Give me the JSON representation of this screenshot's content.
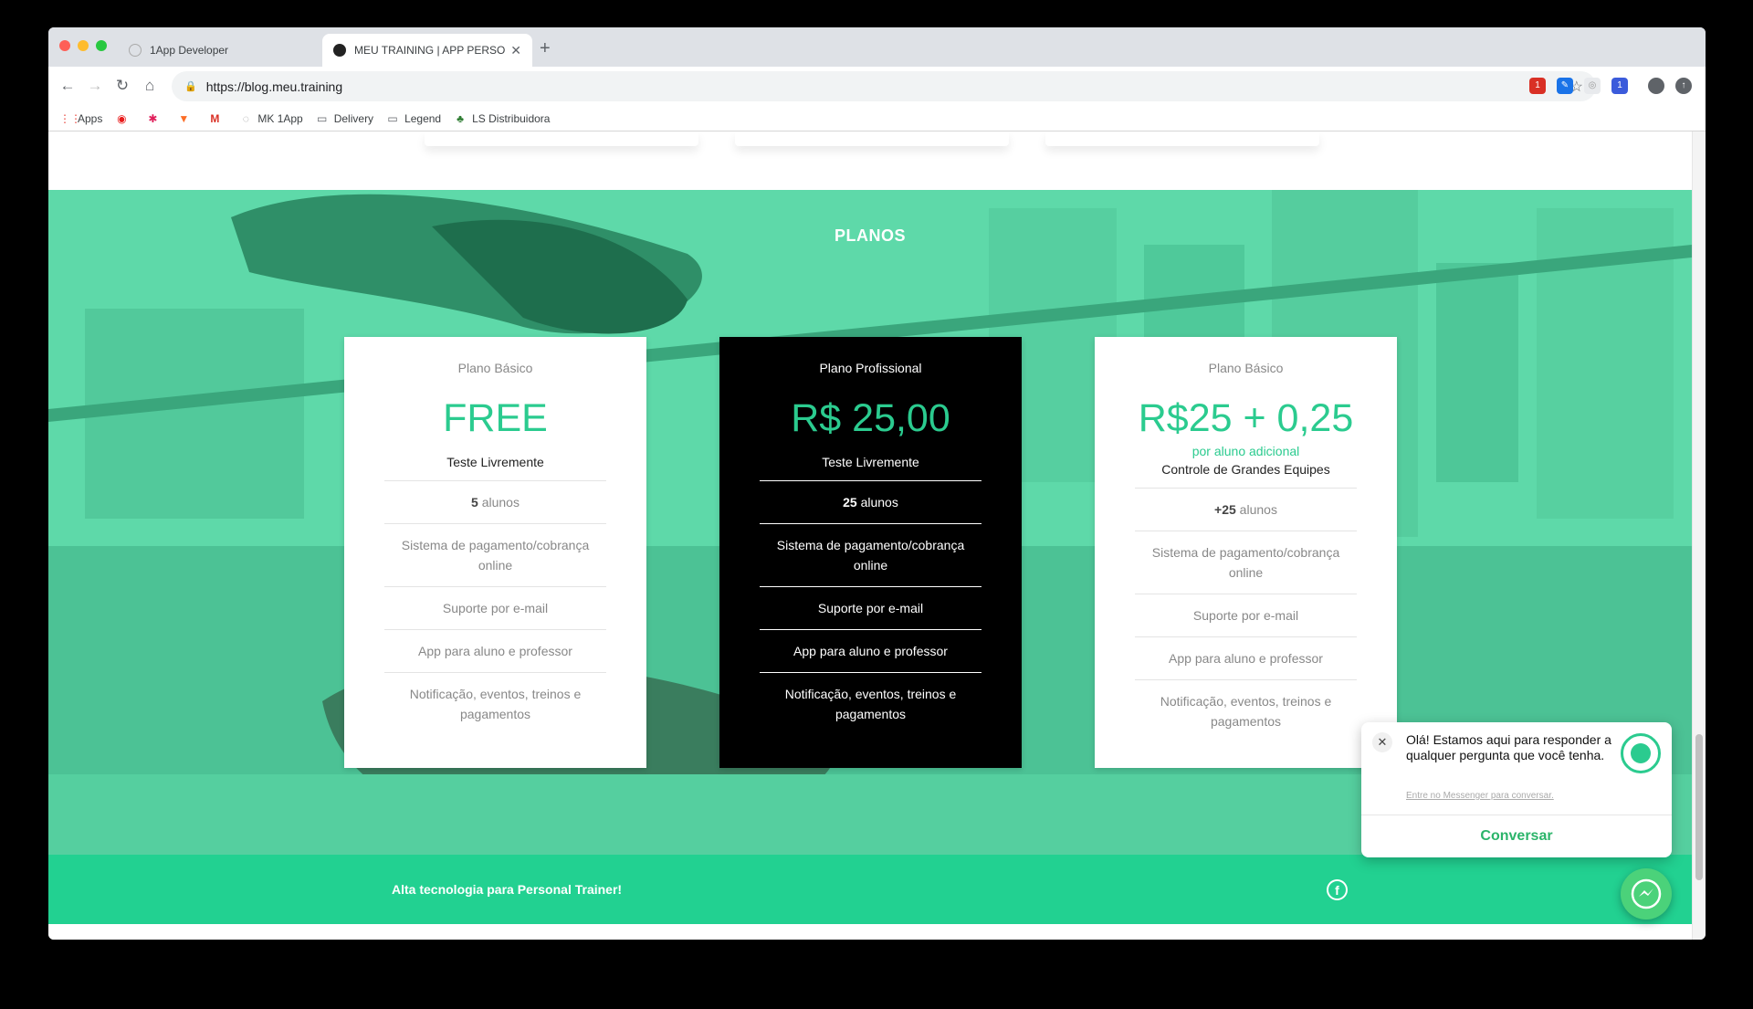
{
  "browser": {
    "tabs": [
      {
        "title": "1App Developer",
        "active": false
      },
      {
        "title": "MEU TRAINING | APP PERSONA",
        "active": true
      }
    ],
    "url": "https://blog.meu.training",
    "bookmarks": [
      "Apps",
      "MK 1App",
      "Delivery",
      "Legend",
      "LS Distribuidora"
    ]
  },
  "section": {
    "title": "PLANOS"
  },
  "plans": [
    {
      "name": "Plano Básico",
      "price": "FREE",
      "lead": "Teste Livremente",
      "features": [
        {
          "strong": "5",
          "text": " alunos"
        },
        {
          "text": "Sistema de pagamento/cobrança online"
        },
        {
          "text": "Suporte por e-mail"
        },
        {
          "text": "App para aluno e professor"
        },
        {
          "text": "Notificação, eventos, treinos e pagamentos"
        }
      ]
    },
    {
      "name": "Plano Profissional",
      "price": "R$ 25,00",
      "lead": "Teste Livremente",
      "features": [
        {
          "strong": "25",
          "text": " alunos"
        },
        {
          "text": "Sistema de pagamento/cobrança online"
        },
        {
          "text": "Suporte por e-mail"
        },
        {
          "text": "App para aluno e professor"
        },
        {
          "text": "Notificação, eventos, treinos e pagamentos"
        }
      ]
    },
    {
      "name": "Plano Básico",
      "price": "R$25 + 0,25",
      "price_sub": "por aluno adicional",
      "lead": "Controle de Grandes Equipes",
      "features": [
        {
          "strong": "+25",
          "text": " alunos"
        },
        {
          "text": "Sistema de pagamento/cobrança online"
        },
        {
          "text": "Suporte por e-mail"
        },
        {
          "text": "App para aluno e professor"
        },
        {
          "text": "Notificação, eventos, treinos e pagamentos"
        }
      ]
    }
  ],
  "footer": {
    "tagline": "Alta tecnologia para Personal Trainer!",
    "social_icon": "facebook-icon"
  },
  "chat": {
    "message": "Olá! Estamos aqui para responder a qualquer pergunta que você tenha.",
    "link": "Entre no Messenger para conversar.",
    "button": "Conversar"
  },
  "colors": {
    "accent": "#2bcb8f",
    "footer": "#22d191",
    "hero_overlay": "#5ed9a9",
    "dark_card": "#000000"
  }
}
